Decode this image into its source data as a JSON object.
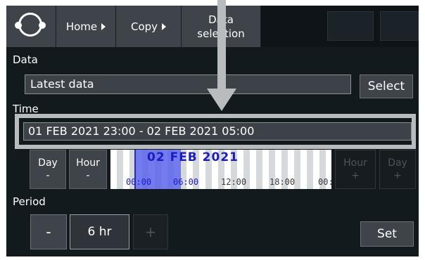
{
  "nav": {
    "home": "Home",
    "copy": "Copy",
    "data_selection_line1": "Data",
    "data_selection_line2": "selection"
  },
  "data_section": {
    "label": "Data",
    "value": "Latest data",
    "select_button": "Select"
  },
  "time_section": {
    "label": "Time",
    "range": "01 FEB 2021 23:00 - 02 FEB 2021 05:00"
  },
  "steppers": {
    "day_minus": {
      "label": "Day",
      "sign": "-"
    },
    "hour_minus": {
      "label": "Hour",
      "sign": "-"
    },
    "hour_plus": {
      "label": "Hour",
      "sign": "+"
    },
    "day_plus": {
      "label": "Day",
      "sign": "+"
    }
  },
  "timeline": {
    "date": "02 FEB 2021",
    "ticks": [
      "00:00",
      "06:00",
      "12:00",
      "18:00",
      "00:"
    ]
  },
  "period_section": {
    "label": "Period",
    "minus": "-",
    "value": "6 hr",
    "plus": "+",
    "set_button": "Set"
  },
  "icons": {
    "menu": "menu-ring-icon",
    "crumb_arrow": "triangle-right-icon",
    "pointer": "down-arrow-icon"
  },
  "colors": {
    "panel": "#131a1e",
    "button": "#3e4449",
    "highlight": "#b9bcbf",
    "timeline_selection": "#5a64eb"
  }
}
